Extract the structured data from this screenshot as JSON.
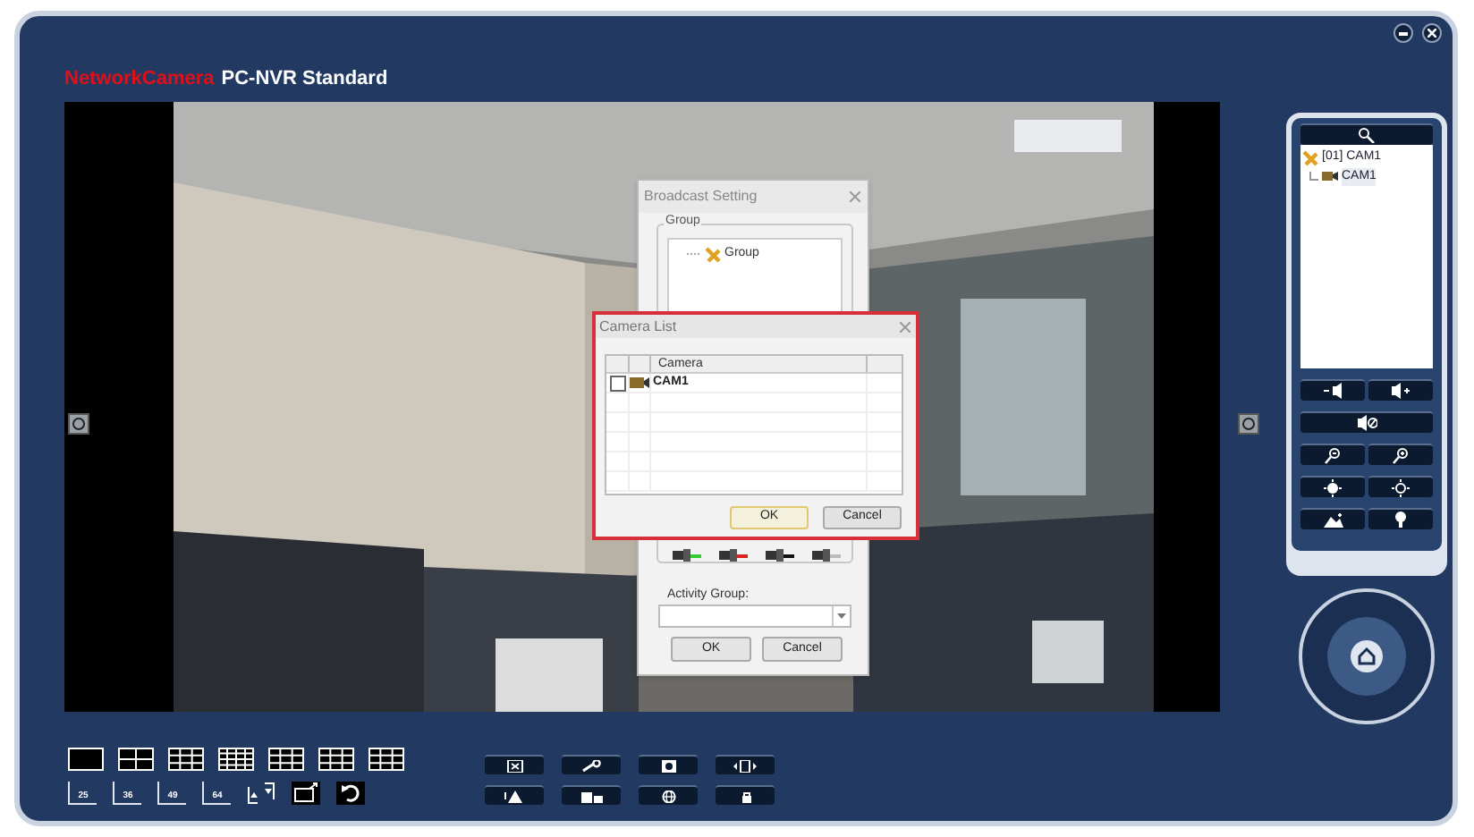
{
  "app": {
    "brand": "NetworkCamera",
    "title": "PC-NVR Standard"
  },
  "broadcast_dialog": {
    "title": "Broadcast Setting",
    "group_label": "Group",
    "tree": [
      {
        "label": "Group"
      }
    ],
    "activity_group_label": "Activity Group:",
    "buttons": [
      "OK",
      "Cancel"
    ]
  },
  "camera_list_dialog": {
    "title": "Camera List",
    "columns": [
      "Camera"
    ],
    "rows": [
      {
        "camera": "CAM1",
        "checked": false
      }
    ],
    "buttons": [
      {
        "label": "OK",
        "focused": true
      },
      {
        "label": "Cancel",
        "focused": false
      }
    ]
  },
  "device_tree": [
    {
      "label": "[01] CAM1",
      "children": [
        {
          "label": "CAM1"
        }
      ]
    }
  ],
  "grid_presets": [
    "25",
    "36",
    "49",
    "64"
  ]
}
